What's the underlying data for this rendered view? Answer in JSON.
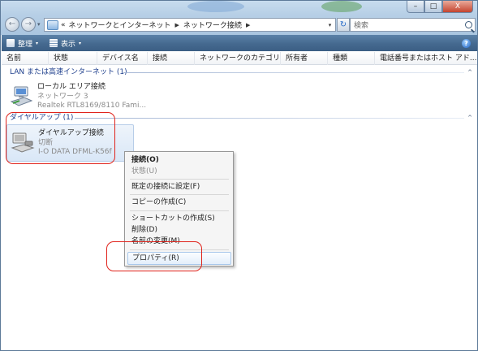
{
  "window": {
    "buttons": {
      "minimize": "–",
      "maximize": "□",
      "close": "X"
    }
  },
  "nav": {
    "back_glyph": "←",
    "forward_glyph": "→",
    "breadcrumb": [
      "«",
      "ネットワークとインターネット",
      "ネットワーク接続"
    ],
    "address_drop": "▾",
    "refresh_glyph": "↻",
    "search_placeholder": "検索"
  },
  "toolbar": {
    "organize": "整理",
    "views": "表示",
    "caret": "▾",
    "help": "?"
  },
  "columns": [
    "名前",
    "状態",
    "デバイス名",
    "接続",
    "ネットワークのカテゴリ",
    "所有者",
    "種類",
    "電話番号またはホスト アド..."
  ],
  "groups": [
    {
      "title": "LAN または高速インターネット (1)",
      "caret": "^",
      "items": [
        {
          "name": "ローカル エリア接続",
          "line2": "ネットワーク 3",
          "line3": "Realtek RTL8169/8110 Fami..."
        }
      ]
    },
    {
      "title": "ダイヤルアップ (1)",
      "caret": "^",
      "items": [
        {
          "name": "ダイヤルアップ接続",
          "line2": "切断",
          "line3": "I-O DATA DFML-K56f"
        }
      ]
    }
  ],
  "context_menu": [
    {
      "label": "接続(O)",
      "bold": true
    },
    {
      "label": "状態(U)",
      "disabled": true
    },
    {
      "label": "既定の接続に設定(F)"
    },
    {
      "label": "コピーの作成(C)"
    },
    {
      "label": "ショートカットの作成(S)"
    },
    {
      "label": "削除(D)"
    },
    {
      "label": "名前の変更(M)"
    },
    {
      "label": "プロパティ(R)",
      "highlighted": true
    }
  ],
  "colors": {
    "annotation": "#e0231b",
    "group_header": "#1e3f8c",
    "toolbar": "#45698f"
  },
  "icons": {
    "lan": "network-adapter-icon",
    "dialup": "dialup-modem-icon"
  }
}
